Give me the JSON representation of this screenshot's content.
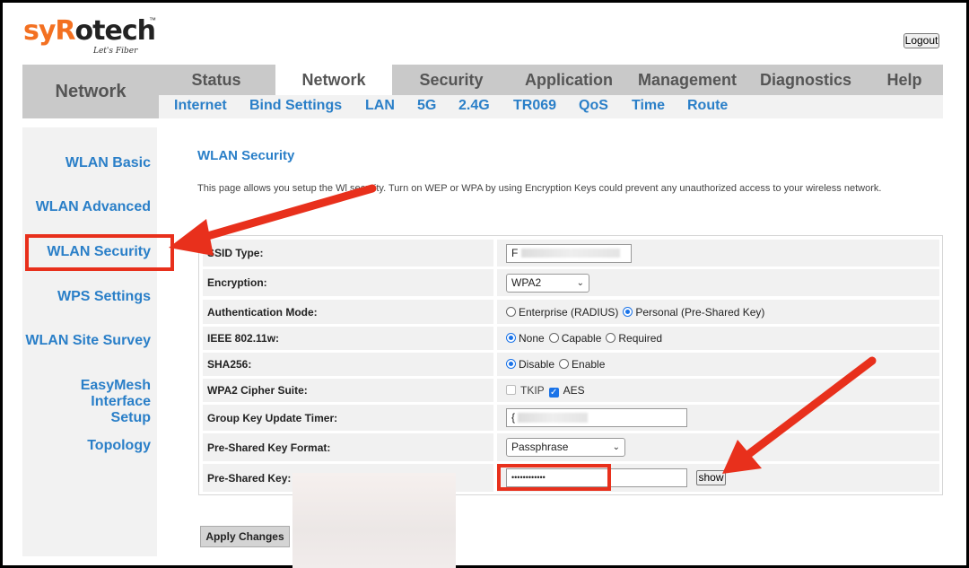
{
  "brand": {
    "logo_prefix": "sy",
    "logo_r": "R",
    "logo_o": "o",
    "logo_suffix": "tech",
    "tm": "™",
    "tagline": "Let's Fiber"
  },
  "header": {
    "logout_label": "Logout"
  },
  "nav": {
    "section_title": "Network",
    "tabs": [
      {
        "label": "Status"
      },
      {
        "label": "Network"
      },
      {
        "label": "Security"
      },
      {
        "label": "Application"
      },
      {
        "label": "Management"
      },
      {
        "label": "Diagnostics"
      },
      {
        "label": "Help"
      }
    ],
    "subtabs": [
      {
        "label": "Internet"
      },
      {
        "label": "Bind Settings"
      },
      {
        "label": "LAN"
      },
      {
        "label": "5G"
      },
      {
        "label": "2.4G"
      },
      {
        "label": "TR069"
      },
      {
        "label": "QoS"
      },
      {
        "label": "Time"
      },
      {
        "label": "Route"
      }
    ],
    "active_tab": "Network"
  },
  "sidebar": {
    "items": [
      {
        "label": "WLAN Basic"
      },
      {
        "label": "WLAN Advanced"
      },
      {
        "label": "WLAN Security"
      },
      {
        "label": "WPS Settings"
      },
      {
        "label": "WLAN Site Survey"
      },
      {
        "label_line1": "EasyMesh Interface",
        "label_line2": "Setup"
      },
      {
        "label": "Topology"
      }
    ],
    "active_item": "WLAN Security"
  },
  "main": {
    "title": "WLAN Security",
    "description_before": "This page allows you setup the W",
    "description_after": "l security. Turn on WEP or WPA by using Encryption Keys could prevent any unauthorized access to your wireless network.",
    "fields": {
      "ssid_type": {
        "label": "SSID Type:",
        "value": "F"
      },
      "encryption": {
        "label": "Encryption:",
        "selected": "WPA2"
      },
      "auth_mode": {
        "label": "Authentication Mode:",
        "opt1": "Enterprise (RADIUS)",
        "opt2": "Personal (Pre-Shared Key)",
        "selected": "Personal (Pre-Shared Key)"
      },
      "ieee": {
        "label": "IEEE 802.11w:",
        "opt1": "None",
        "opt2": "Capable",
        "opt3": "Required",
        "selected": "None"
      },
      "sha256": {
        "label": "SHA256:",
        "opt1": "Disable",
        "opt2": "Enable",
        "selected": "Disable"
      },
      "cipher": {
        "label": "WPA2 Cipher Suite:",
        "opt1": "TKIP",
        "opt2": "AES",
        "tkip_checked": false,
        "aes_checked": true
      },
      "group_key": {
        "label": "Group Key Update Timer:",
        "value": "{"
      },
      "psk_format": {
        "label": "Pre-Shared Key Format:",
        "selected": "Passphrase"
      },
      "psk": {
        "label": "Pre-Shared Key:",
        "value": "••••••••••••",
        "show_label": "show"
      }
    },
    "apply_label": "Apply Changes"
  },
  "colors": {
    "brand_orange": "#f37021",
    "link_blue": "#2a7fc8",
    "annotation_red": "#e8301c",
    "radio_blue": "#1a73e8"
  },
  "icons": {
    "select": "chevron-down-icon",
    "annotation": "arrow-icon"
  }
}
